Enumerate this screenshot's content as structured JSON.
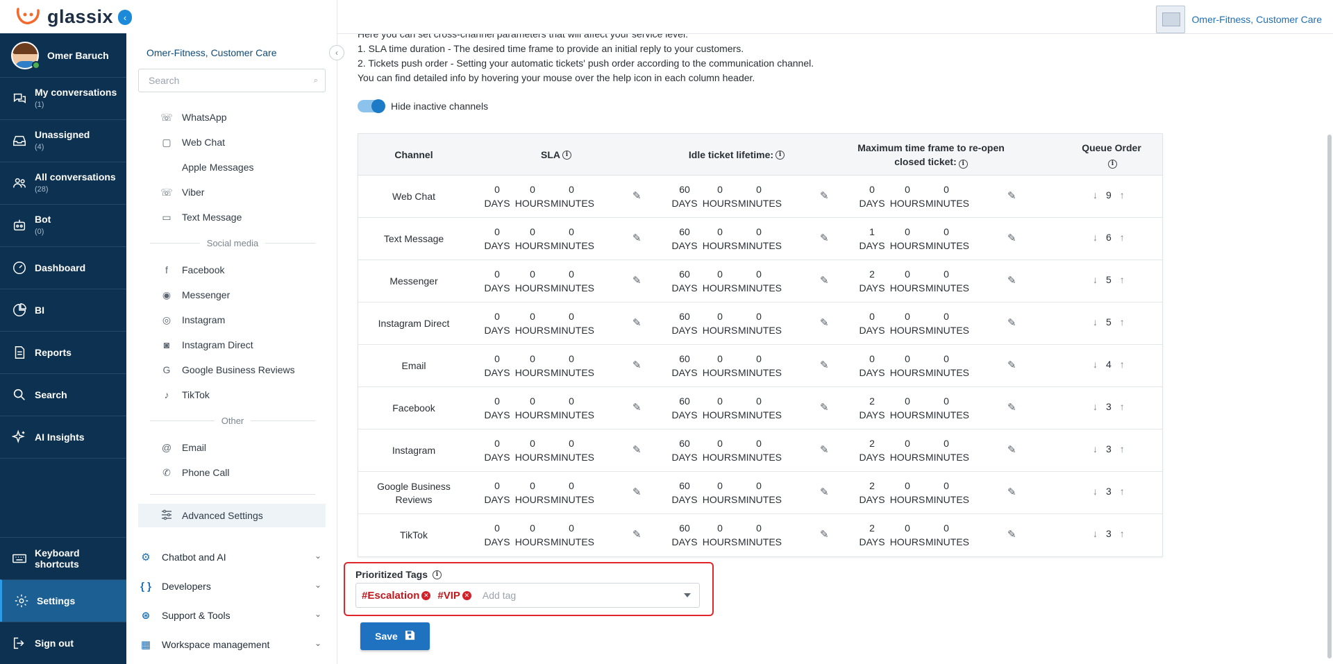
{
  "brand": {
    "name": "glassix"
  },
  "user": {
    "name": "Omer Baruch"
  },
  "rail": {
    "items": [
      {
        "label": "My conversations",
        "count": "(1)",
        "icon": "chat-bubbles-icon"
      },
      {
        "label": "Unassigned",
        "count": "(4)",
        "icon": "inbox-icon"
      },
      {
        "label": "All conversations",
        "count": "(28)",
        "icon": "group-icon"
      },
      {
        "label": "Bot",
        "count": "(0)",
        "icon": "robot-icon"
      },
      {
        "label": "Dashboard",
        "count": "",
        "icon": "gauge-icon"
      },
      {
        "label": "BI",
        "count": "",
        "icon": "pie-chart-icon"
      },
      {
        "label": "Reports",
        "count": "",
        "icon": "report-icon"
      },
      {
        "label": "Search",
        "count": "",
        "icon": "search-icon"
      },
      {
        "label": "AI Insights",
        "count": "",
        "icon": "sparkle-icon"
      }
    ],
    "bottom": [
      {
        "label": "Keyboard shortcuts",
        "icon": "keyboard-icon"
      },
      {
        "label": "Settings",
        "icon": "gear-icon"
      },
      {
        "label": "Sign out",
        "icon": "sign-out-icon"
      }
    ]
  },
  "menu": {
    "title": "Omer-Fitness, Customer Care",
    "search_placeholder": "Search",
    "channels_top": [
      "WhatsApp",
      "Web Chat",
      "Apple Messages",
      "Viber",
      "Text Message"
    ],
    "social_header": "Social media",
    "channels_social": [
      "Facebook",
      "Messenger",
      "Instagram",
      "Instagram Direct",
      "Google Business Reviews",
      "TikTok"
    ],
    "other_header": "Other",
    "channels_other": [
      "Email",
      "Phone Call"
    ],
    "advanced": "Advanced Settings",
    "groups": [
      "Chatbot and AI",
      "Developers",
      "Support & Tools",
      "Workspace management"
    ]
  },
  "topbar": {
    "account": "Omer-Fitness, Customer Care"
  },
  "intro": {
    "line0": "Here you can set cross-channel parameters that will affect your service level:",
    "line1": "1. SLA time duration -  The desired time frame to provide an initial reply to your customers.",
    "line2": "2. Tickets push order - Setting your automatic tickets' push order according to the communication channel.",
    "line3": "You can find detailed info by hovering your mouse over the help icon in each column header."
  },
  "toggle": {
    "label": "Hide inactive channels",
    "on": true
  },
  "table": {
    "headers": {
      "channel": "Channel",
      "sla": "SLA",
      "idle": "Idle ticket lifetime:",
      "reopen": "Maximum time frame to re-open closed ticket:",
      "queue": "Queue Order"
    },
    "units": {
      "days": "DAYS",
      "hours": "HOURS",
      "minutes": "MINUTES"
    },
    "rows": [
      {
        "channel": "Web Chat",
        "sla": [
          "0",
          "0",
          "0"
        ],
        "idle": [
          "60",
          "0",
          "0"
        ],
        "reopen": [
          "0",
          "0",
          "0"
        ],
        "queue": "9"
      },
      {
        "channel": "Text Message",
        "sla": [
          "0",
          "0",
          "0"
        ],
        "idle": [
          "60",
          "0",
          "0"
        ],
        "reopen": [
          "1",
          "0",
          "0"
        ],
        "queue": "6"
      },
      {
        "channel": "Messenger",
        "sla": [
          "0",
          "0",
          "0"
        ],
        "idle": [
          "60",
          "0",
          "0"
        ],
        "reopen": [
          "2",
          "0",
          "0"
        ],
        "queue": "5"
      },
      {
        "channel": "Instagram Direct",
        "sla": [
          "0",
          "0",
          "0"
        ],
        "idle": [
          "60",
          "0",
          "0"
        ],
        "reopen": [
          "0",
          "0",
          "0"
        ],
        "queue": "5"
      },
      {
        "channel": "Email",
        "sla": [
          "0",
          "0",
          "0"
        ],
        "idle": [
          "60",
          "0",
          "0"
        ],
        "reopen": [
          "0",
          "0",
          "0"
        ],
        "queue": "4"
      },
      {
        "channel": "Facebook",
        "sla": [
          "0",
          "0",
          "0"
        ],
        "idle": [
          "60",
          "0",
          "0"
        ],
        "reopen": [
          "2",
          "0",
          "0"
        ],
        "queue": "3"
      },
      {
        "channel": "Instagram",
        "sla": [
          "0",
          "0",
          "0"
        ],
        "idle": [
          "60",
          "0",
          "0"
        ],
        "reopen": [
          "2",
          "0",
          "0"
        ],
        "queue": "3"
      },
      {
        "channel": "Google Business Reviews",
        "sla": [
          "0",
          "0",
          "0"
        ],
        "idle": [
          "60",
          "0",
          "0"
        ],
        "reopen": [
          "2",
          "0",
          "0"
        ],
        "queue": "3"
      },
      {
        "channel": "TikTok",
        "sla": [
          "0",
          "0",
          "0"
        ],
        "idle": [
          "60",
          "0",
          "0"
        ],
        "reopen": [
          "2",
          "0",
          "0"
        ],
        "queue": "3"
      }
    ]
  },
  "tags": {
    "label": "Prioritized Tags",
    "items": [
      "#Escalation",
      "#VIP"
    ],
    "placeholder": "Add tag"
  },
  "save": {
    "label": "Save"
  },
  "colors": {
    "rail": "#0d3150",
    "accent": "#1e72c0",
    "tag_red": "#c0181d",
    "highlight": "#e0262b"
  }
}
